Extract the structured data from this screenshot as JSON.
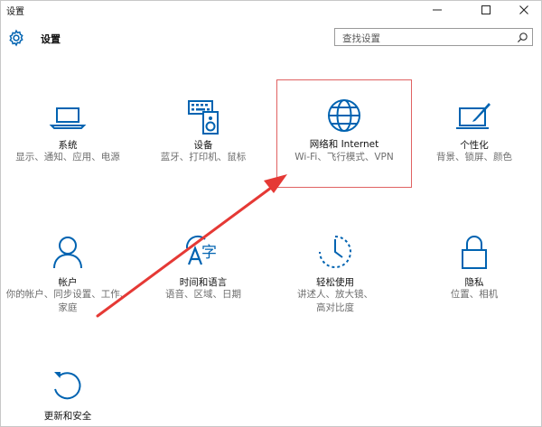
{
  "window": {
    "title": "设置"
  },
  "header": {
    "title": "设置"
  },
  "search": {
    "placeholder": "查找设置"
  },
  "tiles": [
    {
      "label": "系统",
      "desc": "显示、通知、应用、电源",
      "icon": "laptop-icon"
    },
    {
      "label": "设备",
      "desc": "蓝牙、打印机、鼠标",
      "icon": "devices-icon"
    },
    {
      "label": "网络和 Internet",
      "desc": "Wi-Fi、飞行模式、VPN",
      "icon": "globe-icon"
    },
    {
      "label": "个性化",
      "desc": "背景、锁屏、颜色",
      "icon": "personalization-icon"
    },
    {
      "label": "帐户",
      "desc": "你的帐户、同步设置、工作、家庭",
      "icon": "person-icon"
    },
    {
      "label": "时间和语言",
      "desc": "语音、区域、日期",
      "icon": "time-language-icon"
    },
    {
      "label": "轻松使用",
      "desc": "讲述人、放大镜、高对比度",
      "icon": "ease-of-access-icon"
    },
    {
      "label": "隐私",
      "desc": "位置、相机",
      "icon": "lock-icon"
    },
    {
      "label": "更新和安全",
      "desc": "",
      "icon": "update-icon"
    }
  ],
  "colors": {
    "accent": "#0063b1",
    "annotation": "#e53935"
  }
}
